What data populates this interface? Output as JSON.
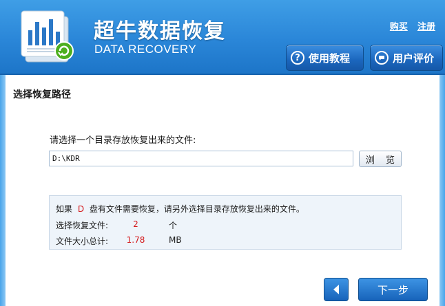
{
  "header": {
    "app_title": "超牛数据恢复",
    "app_subtitle": "DATA RECOVERY",
    "links": {
      "buy": "购买",
      "register": "注册"
    },
    "buttons": {
      "tutorial": {
        "label": "使用教程",
        "icon": "help-icon"
      },
      "review": {
        "label": "用户评价",
        "icon": "chat-icon"
      }
    }
  },
  "main": {
    "section_title": "选择恢复路径",
    "prompt": "请选择一个目录存放恢复出来的文件:",
    "path_value": "D:\\KDR",
    "browse_label": "浏 览",
    "info": {
      "line1_prefix": "如果",
      "drive_letter": "D",
      "line1_suffix": "盘有文件需要恢复，请另外选择目录存放恢复出来的文件。",
      "files_label": "选择恢复文件:",
      "files_value": "2",
      "files_unit": "个",
      "size_label": "文件大小总计:",
      "size_value": "1.78",
      "size_unit": "MB"
    }
  },
  "footer": {
    "next_label": "下一步",
    "back_icon": "back-arrow-icon"
  },
  "colors": {
    "header_blue": "#2a86d8",
    "button_blue": "#1b66bd",
    "accent_red": "#d4181b"
  }
}
